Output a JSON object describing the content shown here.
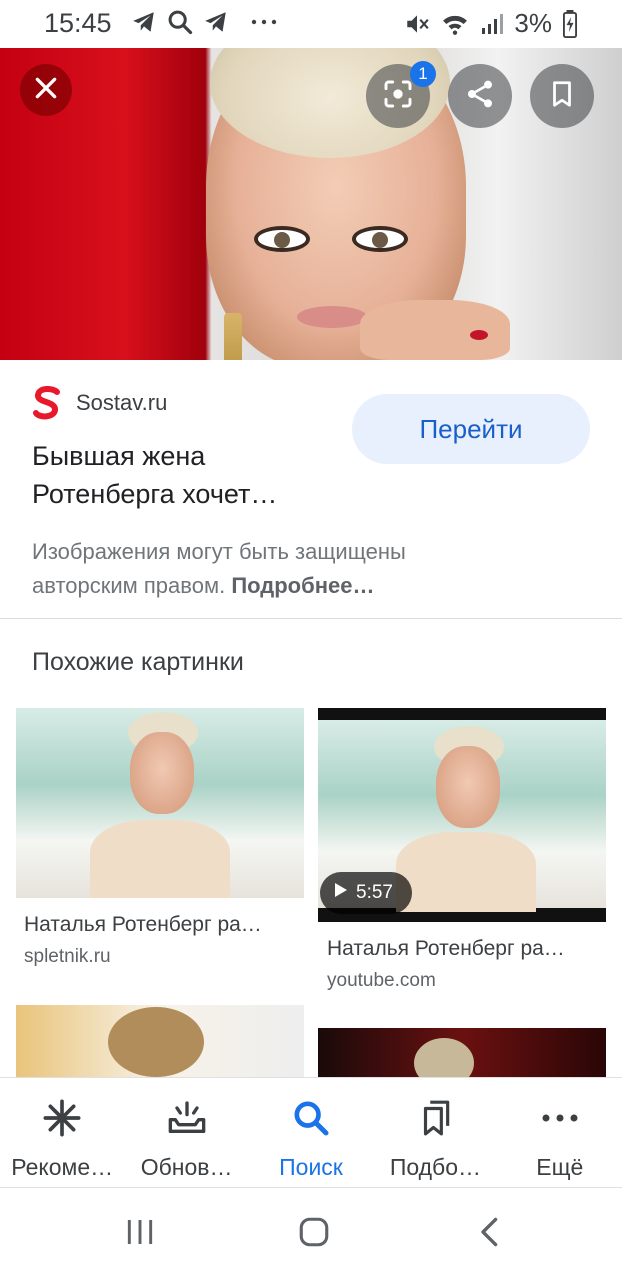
{
  "status_bar": {
    "time": "15:45",
    "battery": "3%",
    "left_icons": [
      "telegram-icon",
      "search-icon",
      "telegram-icon",
      "more-icon"
    ],
    "right_icons": [
      "mute-icon",
      "wifi-icon",
      "signal-icon",
      "battery-icon"
    ]
  },
  "hero": {
    "lens_badge_count": "1",
    "buttons": [
      "close-icon",
      "lens-icon",
      "share-icon",
      "bookmark-icon"
    ]
  },
  "source": {
    "logo_letter": "S",
    "name": "Sostav.ru",
    "title_line1": "Бывшая жена",
    "title_line2": "Ротенберга хочет…",
    "visit_label": "Перейти",
    "copyright_text": "Изображения могут быть защищены авторским правом. ",
    "copyright_link": "Подробнее…"
  },
  "similar": {
    "heading": "Похожие картинки",
    "items": [
      {
        "title": "Наталья Ротенберг ра…",
        "site": "spletnik.ru"
      },
      {
        "title": "Наталья Ротенберг ра…",
        "site": "youtube.com",
        "duration": "5:57"
      }
    ]
  },
  "bottom_nav": [
    {
      "label": "Рекоме…",
      "icon": "asterisk-icon"
    },
    {
      "label": "Обнов…",
      "icon": "inbox-icon"
    },
    {
      "label": "Поиск",
      "icon": "search-icon",
      "active": true
    },
    {
      "label": "Подбо…",
      "icon": "collections-icon"
    },
    {
      "label": "Ещё",
      "icon": "more-icon"
    }
  ],
  "colors": {
    "accent": "#1a73e8",
    "visit_button_bg": "#e8f0fe",
    "logo_red": "#e8192c"
  }
}
